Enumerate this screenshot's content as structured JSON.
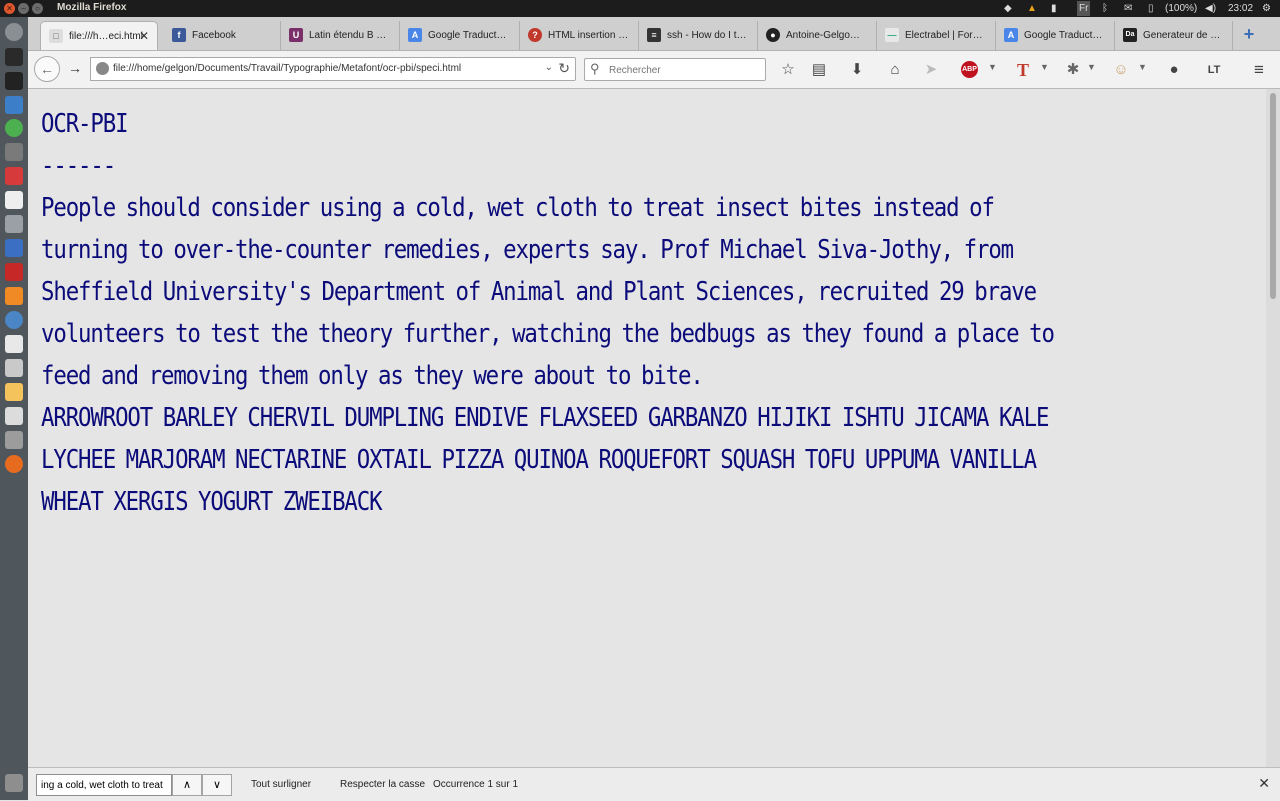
{
  "window": {
    "title": "Mozilla Firefox"
  },
  "tray": {
    "keyboard": "Fr",
    "battery": "(100%)",
    "clock": "23:02"
  },
  "tabs": [
    {
      "label": "file:///h…eci.html",
      "favicon": "file-icon",
      "active": true
    },
    {
      "label": "Facebook",
      "favicon": "facebook-icon"
    },
    {
      "label": "Latin étendu B …",
      "favicon": "unicode-icon"
    },
    {
      "label": "Google Traduct…",
      "favicon": "google-translate-icon"
    },
    {
      "label": "HTML insertion …",
      "favicon": "quora-icon"
    },
    {
      "label": "ssh - How do I t…",
      "favicon": "stackexchange-icon"
    },
    {
      "label": "Antoine-Gelgo…",
      "favicon": "github-icon"
    },
    {
      "label": "Electrabel | For…",
      "favicon": "electrabel-icon"
    },
    {
      "label": "Google Traduct…",
      "favicon": "google-translate-icon"
    },
    {
      "label": "Generateur de …",
      "favicon": "dafont-icon"
    }
  ],
  "navbar": {
    "url": "file:///home/gelgon/Documents/Travail/Typographie/Metafont/ocr-pbi/speci.html",
    "search_placeholder": "Rechercher"
  },
  "document": {
    "heading": "OCR-PBI",
    "rule": "------",
    "paragraph": "People should consider using a cold, wet cloth to treat insect bites instead of turning to over-the-counter remedies, experts say. Prof Michael Siva-Jothy, from Sheffield University's Department of Animal and Plant Sciences, recruited 29 brave volunteers to test the theory further, watching the bedbugs as they found a place to feed and removing them only as they were about to bite.",
    "uppercase": "ARROWROOT BARLEY CHERVIL DUMPLING ENDIVE FLAXSEED GARBANZO HIJIKI ISHTU JICAMA KALE LYCHEE MARJORAM NECTARINE OXTAIL PIZZA QUINOA ROQUEFORT SQUASH TOFU UPPUMA VANILLA WHEAT XERGIS YOGURT ZWEIBACK"
  },
  "findbar": {
    "query": "ing a cold, wet cloth to treat",
    "highlight_all": "Tout surligner",
    "match_case": "Respecter la casse",
    "result": "Occurrence 1 sur 1"
  },
  "colors": {
    "text": "#0b0b7a",
    "page_bg": "#e5e5e5",
    "topbar": "#1c1c1c"
  }
}
